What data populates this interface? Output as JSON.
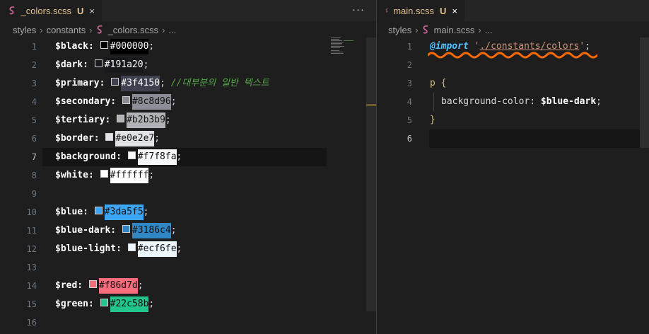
{
  "left_editor": {
    "tab": {
      "filename": "_colors.scss",
      "status": "U",
      "close_glyph": "×"
    },
    "more_actions_glyph": "···",
    "breadcrumb": [
      "styles",
      "constants",
      "_colors.scss",
      "..."
    ],
    "lines": [
      {
        "num": "1",
        "var": "$black:",
        "hex": "#000000",
        "swatch": "#000000",
        "hexbg": "#000000",
        "hexfg": "#ffffff"
      },
      {
        "num": "2",
        "var": "$dark:",
        "hex": "#191a20",
        "swatch": "#191a20",
        "hexbg": "#191a20",
        "hexfg": "#ffffff"
      },
      {
        "num": "3",
        "var": "$primary:",
        "hex": "#3f4150",
        "swatch": "#3f4150",
        "hexbg": "#3f4150",
        "hexfg": "#ffffff",
        "comment": "//대부분의 일반 텍스트"
      },
      {
        "num": "4",
        "var": "$secondary:",
        "hex": "#8c8d96",
        "swatch": "#8c8d96",
        "hexbg": "#8c8d96",
        "hexfg": "#111111"
      },
      {
        "num": "5",
        "var": "$tertiary:",
        "hex": "#b2b3b9",
        "swatch": "#b2b3b9",
        "hexbg": "#b2b3b9",
        "hexfg": "#111111"
      },
      {
        "num": "6",
        "var": "$border:",
        "hex": "#e0e2e7",
        "swatch": "#e0e2e7",
        "hexbg": "#e0e2e7",
        "hexfg": "#111111"
      },
      {
        "num": "7",
        "var": "$background:",
        "hex": "#f7f8fa",
        "swatch": "#f7f8fa",
        "hexbg": "#f7f8fa",
        "hexfg": "#111111",
        "current": true
      },
      {
        "num": "8",
        "var": "$white:",
        "hex": "#ffffff",
        "swatch": "#ffffff",
        "hexbg": "#ffffff",
        "hexfg": "#111111"
      },
      {
        "num": "9"
      },
      {
        "num": "10",
        "var": "$blue:",
        "hex": "#3da5f5",
        "swatch": "#3da5f5",
        "hexbg": "#3da5f5",
        "hexfg": "#111111"
      },
      {
        "num": "11",
        "var": "$blue-dark:",
        "hex": "#3186c4",
        "swatch": "#3186c4",
        "hexbg": "#3186c4",
        "hexfg": "#111111"
      },
      {
        "num": "12",
        "var": "$blue-light:",
        "hex": "#ecf6fe",
        "swatch": "#ecf6fe",
        "hexbg": "#ecf6fe",
        "hexfg": "#111111"
      },
      {
        "num": "13"
      },
      {
        "num": "14",
        "var": "$red:",
        "hex": "#f86d7d",
        "swatch": "#f86d7d",
        "hexbg": "#f86d7d",
        "hexfg": "#111111"
      },
      {
        "num": "15",
        "var": "$green:",
        "hex": "#22c58b",
        "swatch": "#22c58b",
        "hexbg": "#22c58b",
        "hexfg": "#111111"
      },
      {
        "num": "16"
      }
    ]
  },
  "right_editor": {
    "tab": {
      "filename": "main.scss",
      "status": "U",
      "close_glyph": "×"
    },
    "breadcrumb": [
      "styles",
      "main.scss",
      "..."
    ],
    "lines": [
      {
        "num": "1",
        "keyword": "@import",
        "string_open": "'",
        "string_path": "./constants/colors",
        "string_close": "'",
        "semi": ";"
      },
      {
        "num": "2"
      },
      {
        "num": "3",
        "selector": "p",
        "brace": "{"
      },
      {
        "num": "4",
        "property": "background-color:",
        "value": "$blue-dark",
        "semi": ";"
      },
      {
        "num": "5",
        "brace": "}"
      },
      {
        "num": "6",
        "current": true
      }
    ]
  },
  "colors": {
    "background": "#1e1e1e",
    "tab_modified": "#e2c08d",
    "sass_icon": "#cd6799",
    "squiggle": "#ff6a00"
  },
  "icons": {
    "tab_file_icon": "sass-icon",
    "close": "close-icon",
    "more": "more-actions-icon"
  }
}
